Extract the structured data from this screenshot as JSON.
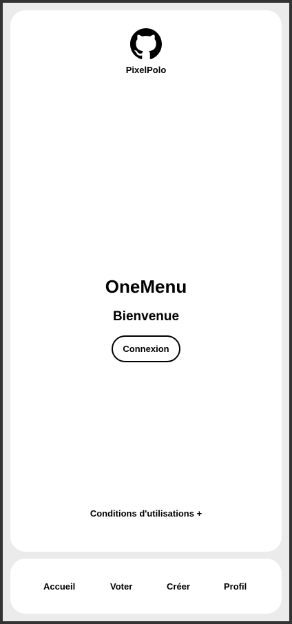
{
  "brand": {
    "name": "PixelPolo",
    "logo_icon": "github-octocat-icon"
  },
  "main": {
    "title": "OneMenu",
    "welcome": "Bienvenue",
    "login_label": "Connexion",
    "terms_label": "Conditions d'utilisations +"
  },
  "nav": {
    "items": [
      {
        "label": "Accueil"
      },
      {
        "label": "Voter"
      },
      {
        "label": "Créer"
      },
      {
        "label": "Profil"
      }
    ]
  },
  "colors": {
    "background": "#ebebeb",
    "card": "#ffffff",
    "text": "#000000",
    "frame_border": "#333333"
  }
}
